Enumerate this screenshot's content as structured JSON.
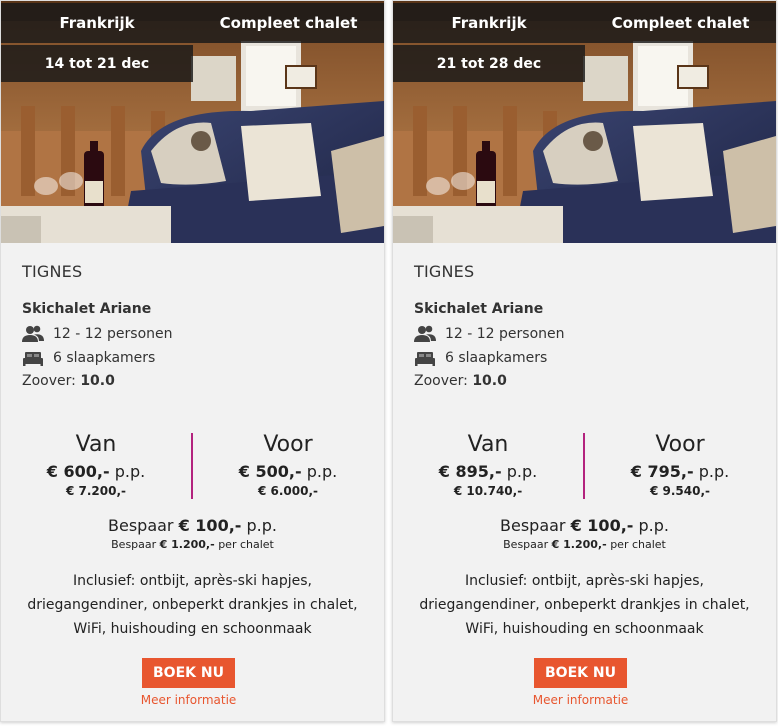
{
  "cards": [
    {
      "country": "Frankrijk",
      "type": "Compleet chalet",
      "dates": "14 tot 21 dec",
      "region": "TIGNES",
      "name": "Skichalet Ariane",
      "guests": "12 - 12 personen",
      "bedrooms": "6 slaapkamers",
      "rating_label": "Zoover:",
      "rating_value": "10.0",
      "from_label": "Van",
      "from_pp": "€ 600,-",
      "from_total": "€ 7.200,-",
      "to_label": "Voor",
      "to_pp": "€ 500,-",
      "to_total": "€ 6.000,-",
      "pp_suffix": "p.p.",
      "save_label": "Bespaar",
      "save_pp": "€ 100,-",
      "save_total": "€ 1.200,-",
      "save_total_suffix": "per chalet",
      "inclusive": "Inclusief: ontbijt, après-ski hapjes, driegangendiner, onbeperkt drankjes in chalet, WiFi, huishouding en schoonmaak",
      "book_label": "BOEK NU",
      "more_label": "Meer informatie"
    },
    {
      "country": "Frankrijk",
      "type": "Compleet chalet",
      "dates": "21 tot 28 dec",
      "region": "TIGNES",
      "name": "Skichalet Ariane",
      "guests": "12 - 12 personen",
      "bedrooms": "6 slaapkamers",
      "rating_label": "Zoover:",
      "rating_value": "10.0",
      "from_label": "Van",
      "from_pp": "€ 895,-",
      "from_total": "€ 10.740,-",
      "to_label": "Voor",
      "to_pp": "€ 795,-",
      "to_total": "€ 9.540,-",
      "pp_suffix": "p.p.",
      "save_label": "Bespaar",
      "save_pp": "€ 100,-",
      "save_total": "€ 1.200,-",
      "save_total_suffix": "per chalet",
      "inclusive": "Inclusief: ontbijt, après-ski hapjes, driegangendiner, onbeperkt drankjes in chalet, WiFi, huishouding en schoonmaak",
      "book_label": "BOEK NU",
      "more_label": "Meer informatie"
    }
  ],
  "colors": {
    "accent": "#e8562f",
    "divider": "#b3237e",
    "card_bg": "#f2f2f2",
    "tag_bg": "#191919"
  },
  "icons": {
    "guests": "users-icon",
    "bedrooms": "bed-icon"
  }
}
